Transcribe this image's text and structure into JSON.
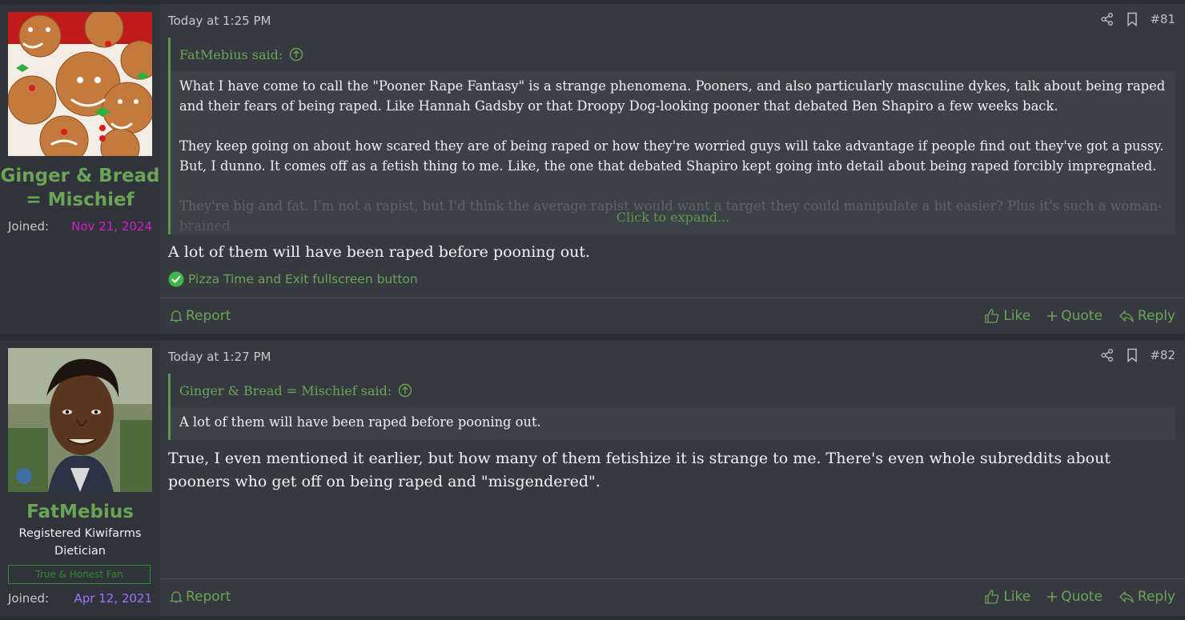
{
  "colors": {
    "accent": "#6aa456",
    "page_bg": "#2a2d32",
    "post_bg": "#363a40",
    "user_cell_bg": "#30343a",
    "joined_date_post1": "#d41fc8",
    "joined_date_post2": "#a071ff"
  },
  "posts": [
    {
      "user": {
        "name": "Ginger & Bread = Mischief",
        "avatar": "gingerbread-cookies",
        "joined_label": "Joined:",
        "joined_date": "Nov 21, 2024"
      },
      "date": "Today at 1:25 PM",
      "post_number": "#81",
      "quote": {
        "author": "FatMebius said:",
        "paragraphs": [
          "What I have come to call the \"Pooner Rape Fantasy\" is a strange phenomena. Pooners, and also particularly masculine dykes, talk about being raped and their fears of being raped. Like Hannah Gadsby or that Droopy Dog-looking pooner that debated Ben Shapiro a few weeks back.",
          "They keep going on about how scared they are of being raped or how they're worried guys will take advantage if people find out they've got a pussy. But, I dunno. It comes off as a fetish thing to me. Like, the one that debated Shapiro kept going into detail about being raped forcibly impregnated.",
          "They're big and fat. I'm not a rapist, but I'd think the average rapist would want a target they could manipulate a bit easier? Plus it's such a woman-brained"
        ],
        "expand_label": "Click to expand..."
      },
      "message": "A lot of them will have been raped before pooning out.",
      "reaction": "Pizza Time and Exit fullscreen button",
      "footer": {
        "report": "Report",
        "like": "Like",
        "quote": "Quote",
        "reply": "Reply"
      }
    },
    {
      "user": {
        "name": "FatMebius",
        "avatar": "man-portrait",
        "title_line1": "Registered Kiwifarms",
        "title_line2": "Dietician",
        "banner": "True & Honest Fan",
        "joined_label": "Joined:",
        "joined_date": "Apr 12, 2021"
      },
      "date": "Today at 1:27 PM",
      "post_number": "#82",
      "quote": {
        "author": "Ginger & Bread = Mischief said:",
        "paragraphs": [
          "A lot of them will have been raped before pooning out."
        ]
      },
      "message": "True, I even mentioned it earlier, but how many of them fetishize it is strange to me. There's even whole subreddits about pooners who get off on being raped and \"misgendered\".",
      "footer": {
        "report": "Report",
        "like": "Like",
        "quote": "Quote",
        "reply": "Reply"
      }
    }
  ]
}
